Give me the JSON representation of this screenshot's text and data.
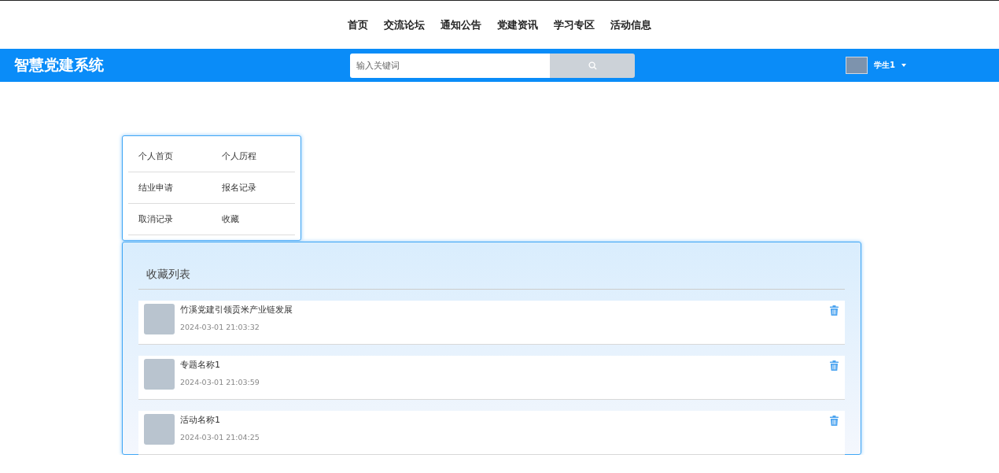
{
  "nav": {
    "items": [
      "首页",
      "交流论坛",
      "通知公告",
      "党建资讯",
      "学习专区",
      "活动信息"
    ]
  },
  "header": {
    "title": "智慧党建系统",
    "search": {
      "placeholder": "输入关键词"
    },
    "user": {
      "name": "学生1"
    }
  },
  "side_menu": {
    "items": [
      "个人首页",
      "个人历程",
      "结业申请",
      "报名记录",
      "取消记录",
      "收藏"
    ]
  },
  "favorites": {
    "title": "收藏列表",
    "items": [
      {
        "title": "竹溪党建引领贡米产业链发展",
        "time": "2024-03-01 21:03:32"
      },
      {
        "title": "专题名称1",
        "time": "2024-03-01 21:03:59"
      },
      {
        "title": "活动名称1",
        "time": "2024-03-01 21:04:25"
      }
    ]
  }
}
